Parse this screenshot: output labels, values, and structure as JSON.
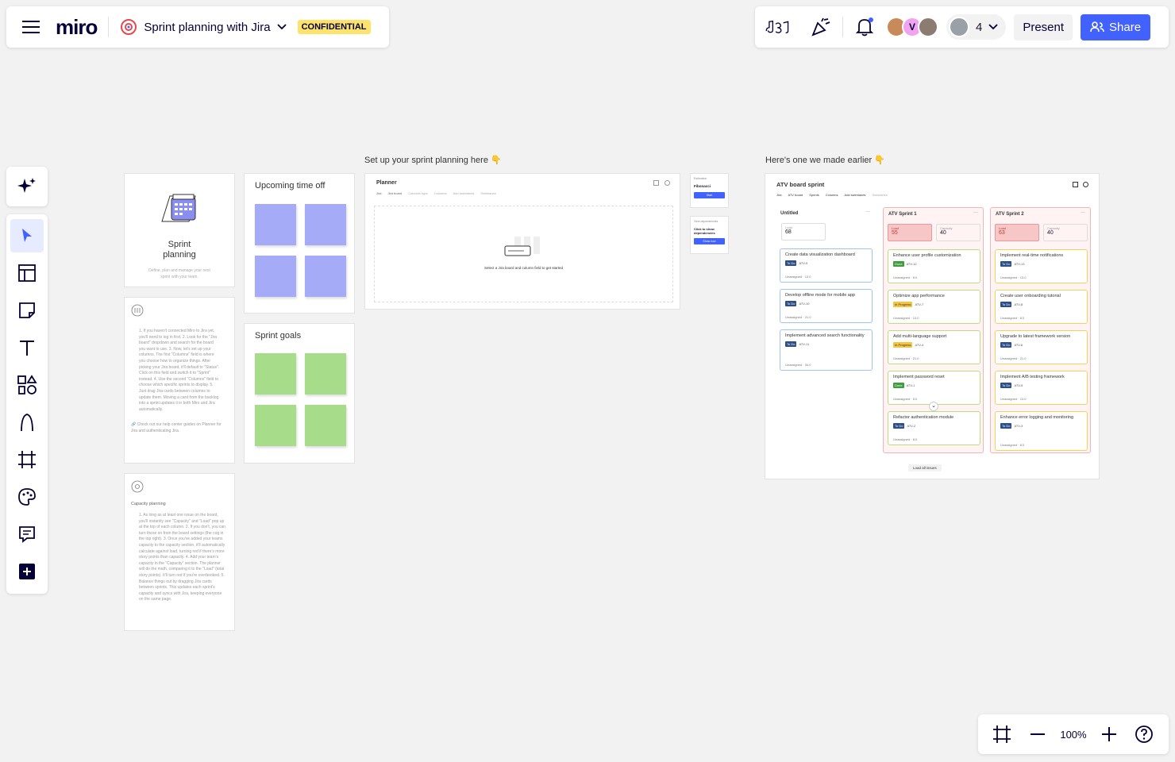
{
  "app": {
    "logo": "miro",
    "board_name": "Sprint planning with Jira",
    "badge": "CONFIDENTIAL"
  },
  "header_right": {
    "reactions_icon": "reactions-icon",
    "celebrate_icon": "party-icon",
    "notifications_icon": "bell-icon",
    "avatar_letter": "V",
    "collaborator_count": "4",
    "present_label": "Present",
    "share_label": "Share"
  },
  "zoom": {
    "value": "100%"
  },
  "canvas": {
    "heading_left": "Set up your sprint planning here 👇",
    "heading_right": "Here's one we made earlier 👇",
    "intro_card": {
      "title": "Sprint planning",
      "subtitle": "Define, plan and manage your next sprint with your team."
    },
    "instructions_card": {
      "steps": "1. If you haven't connected Miro to Jira yet, you'll need to log in first. 2. Look for the \"Jira board\" dropdown and search for the board you want to use. 3. Now, let's set up your columns. The first \"Columns\" field is where you choose how to organize things. After picking your Jira board, it'll default to \"Status\". Click on this field and switch it to \"Sprint\" instead. 4. Use the second \"Columns\" field to choose which specific sprints to display. 5. Just drag Jira cards between columns to update them. Moving a card from the backlog into a sprint updates it in both Miro and Jira automatically.",
      "footer": "🔗 Check out our help center guides on Planner for Jira and authenticating Jira."
    },
    "capacity_card": {
      "title": "Capacity planning",
      "steps": "1. As long as at least one issue on the board, you'll instantly see \"Capacity\" and \"Load\" pop up at the top of each column. 2. If you don't, you can turn these on from the board settings (the cog in the top right). 3. Once you've added your teams capacity to the capacity section, it'll automatically calculate against load, turning red if there's more story points than capacity. 4. Add your team's capacity in the \"Capacity\" section. The planner will do the math, comparing it to the \"Load\" (total story points). It'll turn red if you're overbooked. 5. Balance things out by dragging Jira cards between sprints. This updates each sprint's capacity and syncs with Jira, keeping everyone on the same page."
    },
    "time_off": {
      "title": "Upcoming time off"
    },
    "goals": {
      "title": "Sprint goals"
    },
    "planner": {
      "title": "Planner",
      "filters": [
        "Jira",
        "Jira board",
        "Columns type",
        "Columns",
        "Add swimlanes",
        "Swimlanes"
      ],
      "empty_text": "Select a Jira board and column field to get started"
    },
    "side_widget_1": {
      "label": "Estimation",
      "value": "Fibonacci",
      "button": "Start"
    },
    "side_widget_2": {
      "label": "View dependencies",
      "value": "Click to show dependencies",
      "button": "Show now"
    },
    "atv_board": {
      "title": "ATV board sprint",
      "filters": [
        "Jira",
        "ATV board",
        "Sprints",
        "Columns",
        "Add swimlanes",
        "Swimlanes"
      ],
      "load_all": "Load all issues",
      "columns": [
        {
          "name": "Untitled",
          "load_label": "Load",
          "load": "68",
          "issues": [
            {
              "title": "Create data visualization dashboard",
              "status": "To Do",
              "key": "ATV-9",
              "assignee": "Unassigned",
              "points": "13.0"
            },
            {
              "title": "Develop offline mode for mobile app",
              "status": "To Do",
              "key": "ATV-10",
              "assignee": "Unassigned",
              "points": "21.0"
            },
            {
              "title": "Implement advanced search functionality",
              "status": "To Do",
              "key": "ATV-11",
              "assignee": "Unassigned",
              "points": "34.0"
            }
          ]
        },
        {
          "name": "ATV Sprint 1",
          "load_label": "Load",
          "load": "55",
          "capacity_label": "Capacity",
          "capacity": "40",
          "issues": [
            {
              "title": "Enhance user profile customization",
              "status": "Done",
              "key": "ATV-12",
              "assignee": "Unassigned",
              "points": "8.0"
            },
            {
              "title": "Optimize app performance",
              "status": "In Progress",
              "key": "ATV-7",
              "assignee": "Unassigned",
              "points": "13.0"
            },
            {
              "title": "Add multi-language support",
              "status": "In Progress",
              "key": "ATV-4",
              "assignee": "Unassigned",
              "points": "21.0"
            },
            {
              "title": "Implement password reset",
              "status": "Done",
              "key": "ATV-1",
              "assignee": "Unassigned",
              "points": "5.0"
            },
            {
              "title": "Refactor authentication module",
              "status": "To Do",
              "key": "ATV-2",
              "assignee": "Unassigned",
              "points": "8.0"
            }
          ]
        },
        {
          "name": "ATV Sprint 2",
          "load_label": "Load",
          "load": "63",
          "capacity_label": "Capacity",
          "capacity": "40",
          "issues": [
            {
              "title": "Implement real-time notifications",
              "status": "To Do",
              "key": "ATV-13",
              "assignee": "Unassigned",
              "points": "13.0"
            },
            {
              "title": "Create user onboarding tutorial",
              "status": "To Do",
              "key": "ATV-8",
              "assignee": "Unassigned",
              "points": "8.0"
            },
            {
              "title": "Upgrade to latest framework version",
              "status": "To Do",
              "key": "ATV-6",
              "assignee": "Unassigned",
              "points": "21.0"
            },
            {
              "title": "Implement A/B testing framework",
              "status": "To Do",
              "key": "ATV-5",
              "assignee": "Unassigned",
              "points": "13.0"
            },
            {
              "title": "Enhance error logging and monitoring",
              "status": "To Do",
              "key": "ATV-3",
              "assignee": "Unassigned",
              "points": "8.0"
            }
          ]
        }
      ]
    }
  },
  "colors": {
    "accent": "#4262ff",
    "badge": "#fde36a",
    "overload": "#f7c7c7",
    "sprint1_border": "#f29b9b",
    "sprint2_border": "#f29b9b"
  }
}
